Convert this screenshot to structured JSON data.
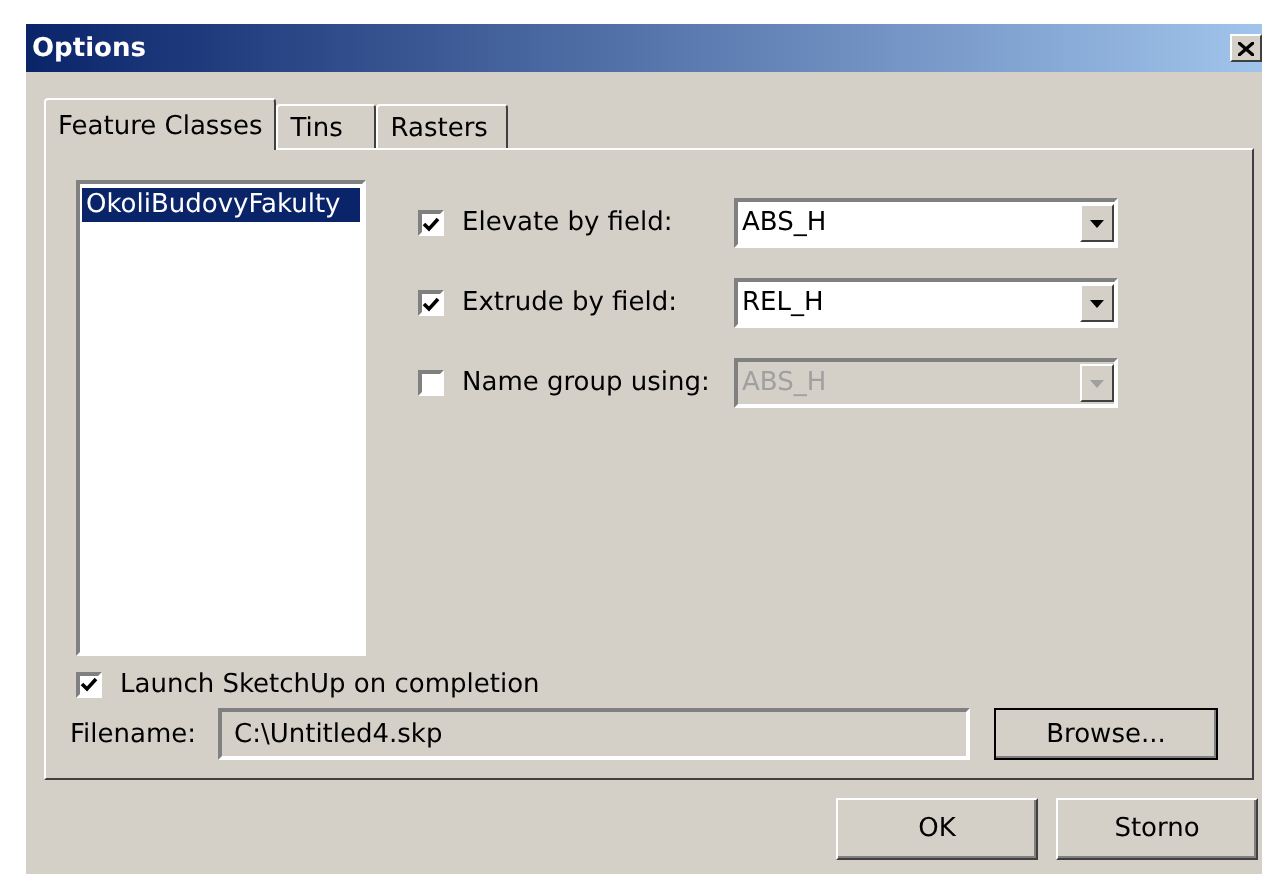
{
  "window": {
    "title": "Options"
  },
  "tabs": [
    {
      "label": "Feature Classes",
      "selected": true
    },
    {
      "label": "Tins",
      "selected": false
    },
    {
      "label": "Rasters",
      "selected": false
    }
  ],
  "feature_classes": [
    {
      "label": "OkoliBudovyFakulty",
      "selected": true
    }
  ],
  "options": [
    {
      "label": "Elevate by field:",
      "checked": true,
      "value": "ABS_H",
      "disabled": false
    },
    {
      "label": "Extrude by field:",
      "checked": true,
      "value": "REL_H",
      "disabled": false
    },
    {
      "label": "Name group using:",
      "checked": false,
      "value": "ABS_H",
      "disabled": true
    }
  ],
  "launch": {
    "label": "Launch SketchUp on completion",
    "checked": true
  },
  "filename": {
    "label": "Filename:",
    "value": "C:\\Untitled4.skp"
  },
  "browse_button": "Browse...",
  "buttons": [
    "OK",
    "Storno"
  ]
}
